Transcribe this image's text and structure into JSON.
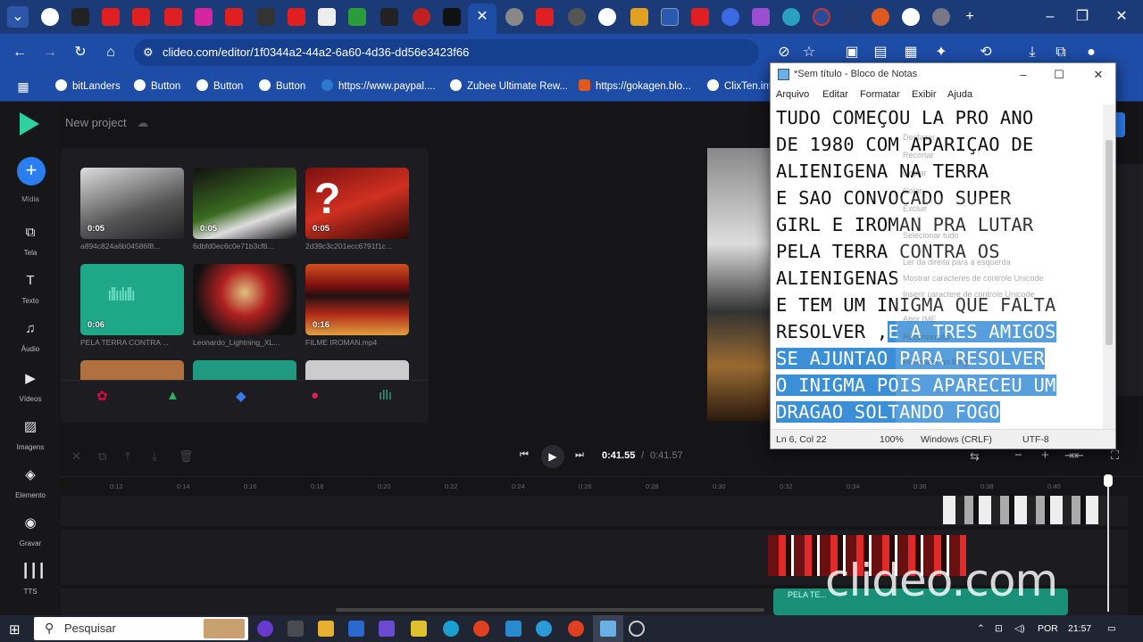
{
  "browser": {
    "url": "clideo.com/editor/1f0344a2-44a2-6a60-4d36-dd56e3423f66",
    "bookmarks": [
      "bitLanders",
      "Button",
      "Button",
      "Button",
      "https://www.paypal....",
      "Zubee Ultimate Rew...",
      "https://gokagen.blo...",
      "ClixTen.inf"
    ]
  },
  "editor": {
    "project_name": "New project",
    "sidebar": [
      {
        "label": "Mídia",
        "icon": "plus-icon"
      },
      {
        "label": "Tela",
        "icon": "screen-icon"
      },
      {
        "label": "Texto",
        "icon": "text-icon"
      },
      {
        "label": "Áudio",
        "icon": "music-icon"
      },
      {
        "label": "Vídeos",
        "icon": "video-icon"
      },
      {
        "label": "Imagens",
        "icon": "image-icon"
      },
      {
        "label": "Elemento",
        "icon": "shapes-icon"
      },
      {
        "label": "Gravar",
        "icon": "record-icon"
      },
      {
        "label": "TTS",
        "icon": "waveform-icon"
      }
    ],
    "media": [
      {
        "name": "a894c824a6b04586f8...",
        "duration": "0:05"
      },
      {
        "name": "6dbfd0ec6c0e71b3cf6...",
        "duration": "0:05"
      },
      {
        "name": "2d39c3c201ecc6791f1c...",
        "duration": "0:05"
      },
      {
        "name": "PELA TERRA CONTRA ...",
        "duration": "0:06"
      },
      {
        "name": "Leonardo_Lightning_XL...",
        "duration": ""
      },
      {
        "name": "FILME IROMAN.mp4",
        "duration": "0:16"
      }
    ],
    "timeline": {
      "current_time": "0:41.55",
      "total_time": "0:41.57",
      "separator": "/",
      "ticks": [
        "0:12",
        "0:14",
        "0:16",
        "0:18",
        "0:20",
        "0:22",
        "0:24",
        "0:26",
        "0:28",
        "0:30",
        "0:32",
        "0:34",
        "0:36",
        "0:38",
        "0:40"
      ],
      "audio_clip_label": "PELA TE..."
    }
  },
  "notepad": {
    "title": "*Sem título - Bloco de Notas",
    "menu": [
      "Arquivo",
      "Editar",
      "Formatar",
      "Exibir",
      "Ajuda"
    ],
    "lines": [
      {
        "plain": "TUDO COMEÇOU LA PRO ANO",
        "selected": ""
      },
      {
        "plain": "DE 1980 COM APARIÇAO DE",
        "selected": ""
      },
      {
        "plain": "ALIENIGENA NA TERRA",
        "selected": ""
      },
      {
        "plain": "E SAO CONVOCADO SUPER",
        "selected": ""
      },
      {
        "plain": "GIRL E IROMAN PRA LUTAR",
        "selected": ""
      },
      {
        "plain": "PELA TERRA CONTRA OS",
        "selected": ""
      },
      {
        "plain": "ALIENIGENAS",
        "selected": ""
      },
      {
        "plain": "E TEM UM INIGMA QUE FALTA",
        "selected": ""
      },
      {
        "plain": "RESOLVER ,",
        "selected": "E A TRES AMIGOS"
      },
      {
        "plain": "",
        "selected": "SE AJUNTAO PARA RESOLVER"
      },
      {
        "plain": "",
        "selected": "O INIGMA POIS APARECEU UM"
      },
      {
        "plain": "",
        "selected": "DRAGAO SOLTANDO FOGO"
      }
    ],
    "context_menu": [
      "Desfazer",
      "Recortar",
      "Copiar",
      "Colar",
      "Excluir",
      "Selecionar tudo",
      "Ler da direita para a esquerda",
      "Mostrar caracteres de controle Unicode",
      "Inserir caractere de controle Unicode",
      "Abrir IME",
      "Reconversão",
      "Pesquisar no Bing..."
    ],
    "status": {
      "position": "Ln 6, Col 22",
      "zoom": "100%",
      "line_ending": "Windows (CRLF)",
      "encoding": "UTF-8"
    }
  },
  "watermark": "clideo.com",
  "taskbar": {
    "search_placeholder": "Pesquisar",
    "language": "POR",
    "time": "21:57"
  }
}
